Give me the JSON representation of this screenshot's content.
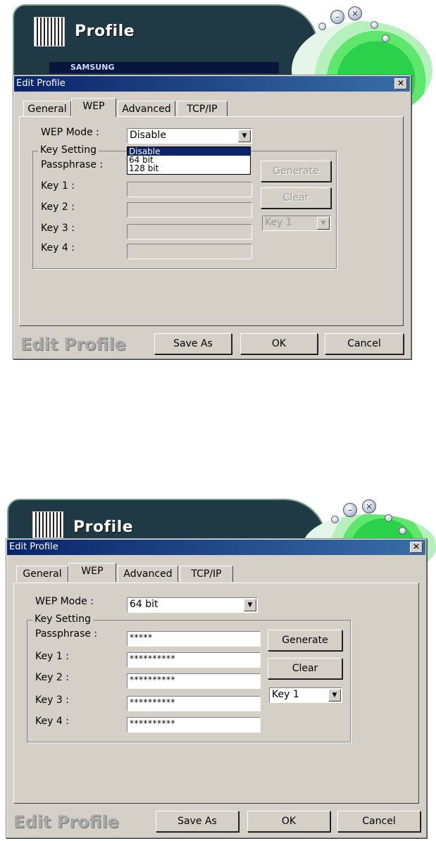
{
  "app": {
    "title": "Profile",
    "banner_text": "SAMSUNG"
  },
  "dialog": {
    "title": "Edit Profile",
    "close_glyph": "✕",
    "tabs": [
      "General",
      "WEP",
      "Advanced",
      "TCP/IP"
    ],
    "wep_mode_label": "WEP Mode :",
    "key_setting_label": "Key Setting",
    "passphrase_label": "Passphrase :",
    "key_labels": [
      "Key 1 :",
      "Key 2 :",
      "Key 3 :",
      "Key 4 :"
    ],
    "generate_label": "Generate",
    "clear_label": "Clear",
    "footer_title": "Edit Profile",
    "save_as_label": "Save As",
    "ok_label": "OK",
    "cancel_label": "Cancel"
  },
  "state1": {
    "wep_mode_value": "Disable",
    "dropdown_options": [
      "Disable",
      "64 bit",
      "128 bit"
    ],
    "dropdown_selected": "Disable",
    "default_key_value": "Key 1"
  },
  "state2": {
    "wep_mode_value": "64 bit",
    "passphrase_value": "*****",
    "key_values": [
      "**********",
      "**********",
      "**********",
      "**********"
    ],
    "default_key_value": "Key 1"
  },
  "icons": {
    "dropdown_arrow": "▼",
    "minimize": "–",
    "close": "×"
  }
}
